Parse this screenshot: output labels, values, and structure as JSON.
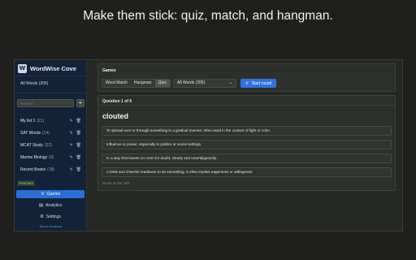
{
  "headline": "Make them stick: quiz, match, and hangman.",
  "app": {
    "brand": "WordWise Cove",
    "logo_glyph": "W",
    "sidebar": {
      "all_words": "All Words (205)",
      "new_list_placeholder": "New list",
      "add_label": "+",
      "lists": [
        {
          "name": "My list 1",
          "count": "(21)"
        },
        {
          "name": "SAT Words",
          "count": "(14)"
        },
        {
          "name": "MCAT Study",
          "count": "(22)"
        },
        {
          "name": "Marine Biology",
          "count": "(0)"
        },
        {
          "name": "Recent Books",
          "count": "(18)"
        }
      ],
      "premium": "Premium",
      "nav": [
        {
          "label": "Games",
          "icon": "trophy-icon",
          "active": true
        },
        {
          "label": "Analytics",
          "icon": "chart-icon",
          "active": false
        },
        {
          "label": "Settings",
          "icon": "gear-icon",
          "active": false
        }
      ],
      "feedback": "Share feedback"
    },
    "games": {
      "title": "Games",
      "tabs": [
        "Word Match",
        "Hangman",
        "Quiz"
      ],
      "active_tab": "Quiz",
      "select_value": "All Words (205)",
      "start_label": "Start round"
    },
    "quiz": {
      "question_number": "Question 1 of 6",
      "word": "clouted",
      "options": [
        "To spread over or through something in a gradual manner, often used in the context of light or color.",
        "Influence or power, especially in politics or social settings.",
        "In a way that leaves no room for doubt; clearly and unambiguously.",
        "A brisk and cheerful readiness to do something. It often implies eagerness or willingness."
      ],
      "score": "Score so far: 0/0"
    }
  },
  "colors": {
    "accent": "#2b6fd6",
    "sidebar_bg": "#132238",
    "premium": "#b9cf63"
  }
}
